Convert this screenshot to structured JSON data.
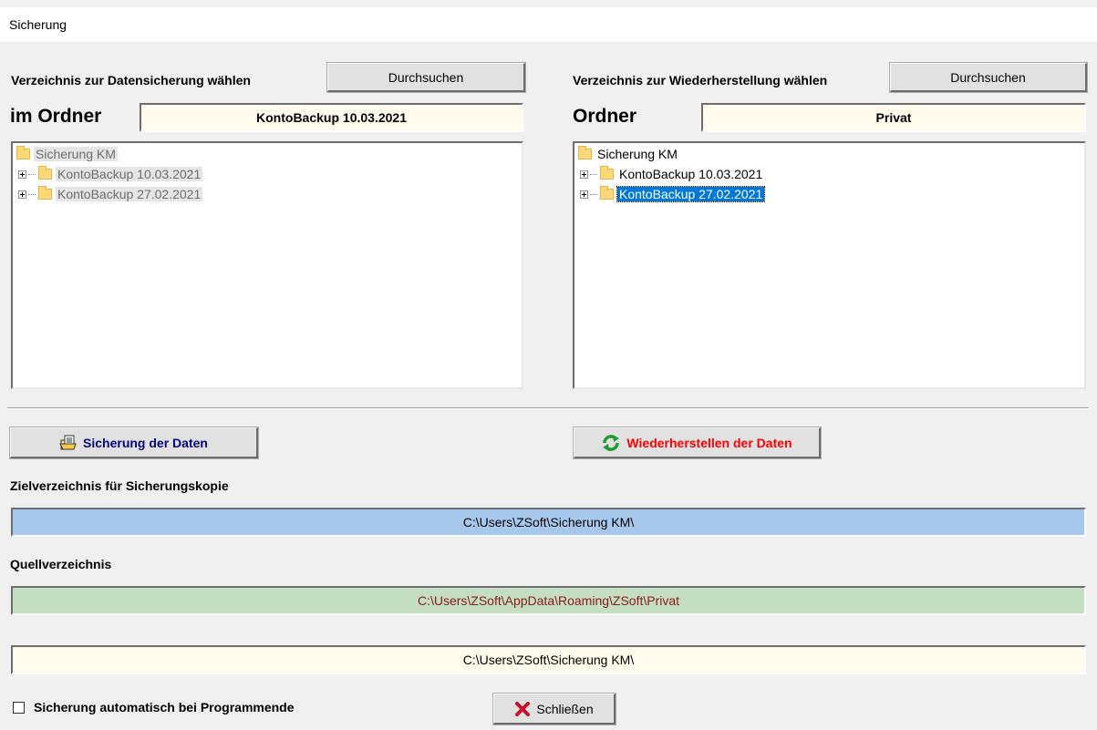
{
  "window": {
    "title": "Sicherung"
  },
  "left": {
    "heading": "Verzeichnis zur Datensicherung wählen",
    "browse_label": "Durchsuchen",
    "folder_label": "im Ordner",
    "folder_value": "KontoBackup 10.03.2021",
    "tree": {
      "root": "Sicherung KM",
      "children": [
        "KontoBackup 10.03.2021",
        "KontoBackup 27.02.2021"
      ]
    }
  },
  "right": {
    "heading": "Verzeichnis zur Wiederherstellung wählen",
    "browse_label": "Durchsuchen",
    "folder_label": "Ordner",
    "folder_value": "Privat",
    "tree": {
      "root": "Sicherung KM",
      "children": [
        "KontoBackup 10.03.2021",
        "KontoBackup 27.02.2021"
      ],
      "selected": "KontoBackup 27.02.2021"
    }
  },
  "actions": {
    "backup_label": "Sicherung der Daten",
    "restore_label": "Wiederherstellen der Daten"
  },
  "target": {
    "label": "Zielverzeichnis für Sicherungskopie",
    "path": "C:\\Users\\ZSoft\\Sicherung KM\\"
  },
  "source": {
    "label": "Quellverzeichnis",
    "path": "C:\\Users\\ZSoft\\AppData\\Roaming\\ZSoft\\Privat"
  },
  "extra_path": "C:\\Users\\ZSoft\\Sicherung KM\\",
  "auto_backup": {
    "label": "Sicherung automatisch bei Programmende",
    "checked": false
  },
  "close_label": "Schließen",
  "colors": {
    "target_bg": "#a6c8ec",
    "source_bg": "#c4dec2",
    "source_text": "#8b1a1a",
    "field_bg": "#fffbed",
    "backup_text": "#000080",
    "restore_text": "#ff0000",
    "selection": "#0078d7"
  },
  "icons": {
    "backup": "backup-document-icon",
    "restore": "refresh-arrows-icon",
    "close": "red-x-icon",
    "folder": "folder-icon"
  }
}
